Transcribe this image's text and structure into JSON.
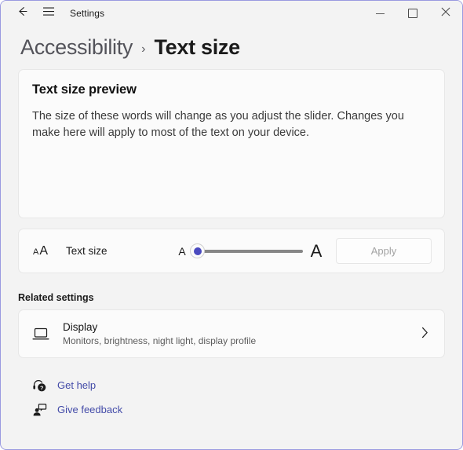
{
  "titlebar": {
    "back_icon": "back-arrow-icon",
    "menu_icon": "hamburger-menu-icon",
    "app_title": "Settings",
    "minimize_label": "Minimize",
    "maximize_label": "Maximize",
    "close_glyph": "✕"
  },
  "breadcrumb": {
    "parent": "Accessibility",
    "separator": "›",
    "current": "Text size"
  },
  "preview": {
    "title": "Text size preview",
    "body": "The size of these words will change as you adjust the slider. Changes you make here will apply to most of the text on your device."
  },
  "text_size": {
    "icon_small": "A",
    "icon_large": "A",
    "label": "Text size",
    "slider_min_glyph": "A",
    "slider_max_glyph": "A",
    "slider_value": 0,
    "slider_min": 0,
    "slider_max": 100,
    "apply_label": "Apply",
    "apply_enabled": false,
    "thumb_color": "#4a4abf",
    "track_color": "#868686"
  },
  "related": {
    "section_title": "Related settings",
    "items": [
      {
        "icon": "laptop-display-icon",
        "title": "Display",
        "subtitle": "Monitors, brightness, night light, display profile",
        "chevron": "›"
      }
    ]
  },
  "help_links": [
    {
      "icon": "get-help-icon",
      "label": "Get help"
    },
    {
      "icon": "give-feedback-icon",
      "label": "Give feedback"
    }
  ],
  "colors": {
    "window_border": "#9a9ae0",
    "page_background": "#f3f3f3",
    "card_background": "#fbfbfb",
    "link": "#434ba8",
    "accent": "#4a4abf"
  }
}
